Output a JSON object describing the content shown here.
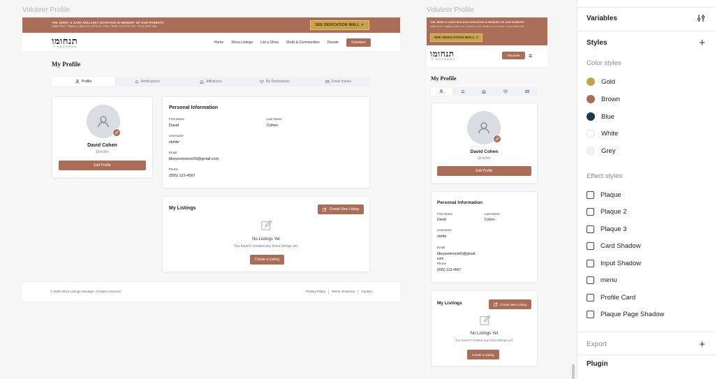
{
  "colors": {
    "brown": "#a96d58",
    "gold": "#c8a24a",
    "blue": "#1f3a4d",
    "white": "#ffffff",
    "grey": "#f2f2f2"
  },
  "frames": {
    "desktop_label": "Voluteer Profile",
    "mobile_label": "Voluteer Profile"
  },
  "banner": {
    "line1": "THE JERRY & SARA WOLASKY INITIATIVE IN MEMORY OF OUR PARENTS",
    "line2": "מאיר שלום בן דוד • חנה פרידה בת ישראל • מרדכי בן אליהו • הרב משה בן שמואל • לעילוי נשמת",
    "cta": "SEE DEDICATION WALL",
    "cta_mobile": "SEE DEDICATION WALL"
  },
  "logo": {
    "hebrew": "תנחומו",
    "english": "T'NUCHAMU"
  },
  "nav": {
    "links": [
      "Home",
      "Shiva Listings",
      "List a Shiva",
      "Shuls & Communities",
      "Donate"
    ],
    "volunteer": "Volunteer"
  },
  "profile": {
    "title": "My Profile",
    "tabs": [
      "Profile",
      "Notifications",
      "Affiliations",
      "My Dedications",
      "Email Invites"
    ],
    "tab_icons": [
      "user-icon",
      "bell-icon",
      "building-icon",
      "heart-icon",
      "mail-icon"
    ],
    "name": "David Cohen",
    "username_handle": "@stvhbr",
    "edit_button": "Edit Profile"
  },
  "personal": {
    "title": "Personal Information",
    "first_name_label": "First Name",
    "first_name": "David",
    "last_name_label": "Last Name",
    "last_name": "Cohen",
    "username_label": "Username",
    "username": "stvhbr",
    "email_label": "Email",
    "email": "bboysomeone00@gmail.com",
    "email_mobile_a": "bboysomeone00@gmail.",
    "email_mobile_b": "com",
    "phone_label": "Phone",
    "phone": "(555) 123-4567"
  },
  "listings": {
    "title": "My Listings",
    "create_new": "Create New Listing",
    "empty_title": "No Listings Yet",
    "empty_text": "You haven't created any shiva listings yet.",
    "create_button": "Create a Listing"
  },
  "footer": {
    "copyright": "© 2025 Shiva Listings Manager. All rights reserved.",
    "links": [
      "Privacy Policy",
      "Terms of Service",
      "Contact"
    ]
  },
  "panel": {
    "variables": "Variables",
    "styles": "Styles",
    "color_styles": "Color styles",
    "colors": [
      {
        "name": "Gold",
        "hex": "#c8a24a"
      },
      {
        "name": "Brown",
        "hex": "#a96d58"
      },
      {
        "name": "Blue",
        "hex": "#1f3a4d"
      },
      {
        "name": "White",
        "hex": "#ffffff"
      },
      {
        "name": "Grey",
        "hex": "#f2f2f2"
      }
    ],
    "effect_styles": "Effect styles",
    "effects": [
      "Plaque",
      "Plaque 2",
      "Plaque 3",
      "Card Shadow",
      "Input Shadow",
      "menu",
      "Profile Card",
      "Plaque Page Shadow"
    ],
    "export": "Export",
    "plugin": "Plugin"
  }
}
